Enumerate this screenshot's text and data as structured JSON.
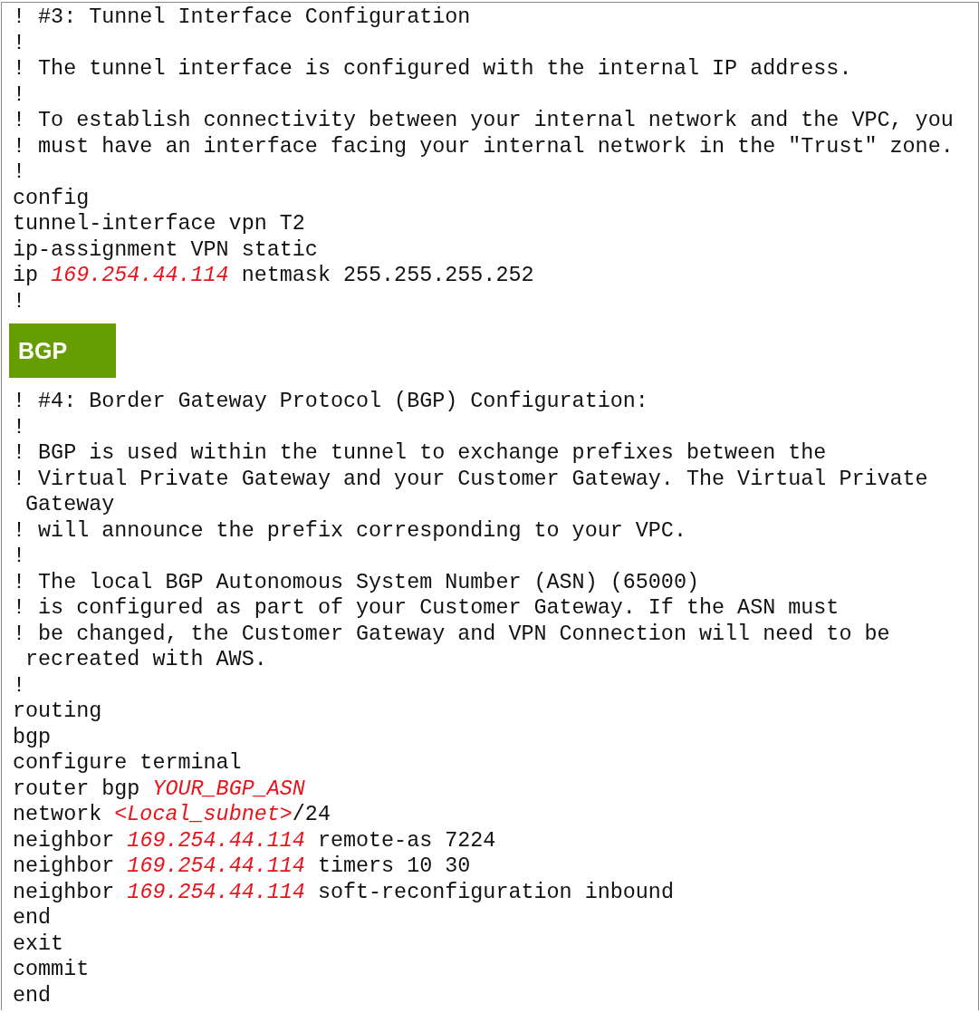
{
  "blocks": [
    {
      "kind": "code",
      "lines": [
        [
          {
            "kind": "plain",
            "text": "! #3: Tunnel Interface Configuration"
          }
        ],
        [
          {
            "kind": "plain",
            "text": "!"
          }
        ],
        [
          {
            "kind": "plain",
            "text": "! The tunnel interface is configured with the internal IP address."
          }
        ],
        [
          {
            "kind": "plain",
            "text": "!"
          }
        ],
        [
          {
            "kind": "plain",
            "text": "! To establish connectivity between your internal network and the VPC, you"
          }
        ],
        [
          {
            "kind": "plain",
            "text": "! must have an interface facing your internal network in the \"Trust\" zone."
          }
        ],
        [
          {
            "kind": "plain",
            "text": "!"
          }
        ],
        [
          {
            "kind": "plain",
            "text": "config"
          }
        ],
        [
          {
            "kind": "plain",
            "text": "tunnel-interface vpn T2"
          }
        ],
        [
          {
            "kind": "plain",
            "text": "ip-assignment VPN static"
          }
        ],
        [
          {
            "kind": "plain",
            "text": "ip "
          },
          {
            "kind": "variable",
            "text": "169.254.44.114"
          },
          {
            "kind": "plain",
            "text": " netmask 255.255.255.252"
          }
        ],
        [
          {
            "kind": "plain",
            "text": "!"
          }
        ]
      ]
    },
    {
      "kind": "badge",
      "text": "BGP"
    },
    {
      "kind": "code",
      "lines": [
        [
          {
            "kind": "plain",
            "text": "! #4: Border Gateway Protocol (BGP) Configuration:"
          }
        ],
        [
          {
            "kind": "plain",
            "text": "!"
          }
        ],
        [
          {
            "kind": "plain",
            "text": "! BGP is used within the tunnel to exchange prefixes between the"
          }
        ],
        [
          {
            "kind": "plain",
            "text": "! Virtual Private Gateway and your Customer Gateway. The Virtual Private"
          }
        ],
        [
          {
            "kind": "plain",
            "text": " Gateway"
          }
        ],
        [
          {
            "kind": "plain",
            "text": "! will announce the prefix corresponding to your VPC."
          }
        ],
        [
          {
            "kind": "plain",
            "text": "!"
          }
        ],
        [
          {
            "kind": "plain",
            "text": "! The local BGP Autonomous System Number (ASN) (65000)"
          }
        ],
        [
          {
            "kind": "plain",
            "text": "! is configured as part of your Customer Gateway. If the ASN must"
          }
        ],
        [
          {
            "kind": "plain",
            "text": "! be changed, the Customer Gateway and VPN Connection will need to be"
          }
        ],
        [
          {
            "kind": "plain",
            "text": " recreated with AWS."
          }
        ],
        [
          {
            "kind": "plain",
            "text": "!"
          }
        ],
        [
          {
            "kind": "plain",
            "text": "routing"
          }
        ],
        [
          {
            "kind": "plain",
            "text": "bgp"
          }
        ],
        [
          {
            "kind": "plain",
            "text": "configure terminal"
          }
        ],
        [
          {
            "kind": "plain",
            "text": "router bgp "
          },
          {
            "kind": "variable",
            "text": "YOUR_BGP_ASN"
          }
        ],
        [
          {
            "kind": "plain",
            "text": "network "
          },
          {
            "kind": "variable",
            "text": "<Local_subnet>"
          },
          {
            "kind": "plain",
            "text": "/24"
          }
        ],
        [
          {
            "kind": "plain",
            "text": "neighbor "
          },
          {
            "kind": "variable",
            "text": "169.254.44.114"
          },
          {
            "kind": "plain",
            "text": " remote-as 7224"
          }
        ],
        [
          {
            "kind": "plain",
            "text": "neighbor "
          },
          {
            "kind": "variable",
            "text": "169.254.44.114"
          },
          {
            "kind": "plain",
            "text": " timers 10 30"
          }
        ],
        [
          {
            "kind": "plain",
            "text": "neighbor "
          },
          {
            "kind": "variable",
            "text": "169.254.44.114"
          },
          {
            "kind": "plain",
            "text": " soft-reconfiguration inbound"
          }
        ],
        [
          {
            "kind": "plain",
            "text": "end"
          }
        ],
        [
          {
            "kind": "plain",
            "text": "exit"
          }
        ],
        [
          {
            "kind": "plain",
            "text": "commit"
          }
        ],
        [
          {
            "kind": "plain",
            "text": "end"
          }
        ]
      ]
    }
  ]
}
